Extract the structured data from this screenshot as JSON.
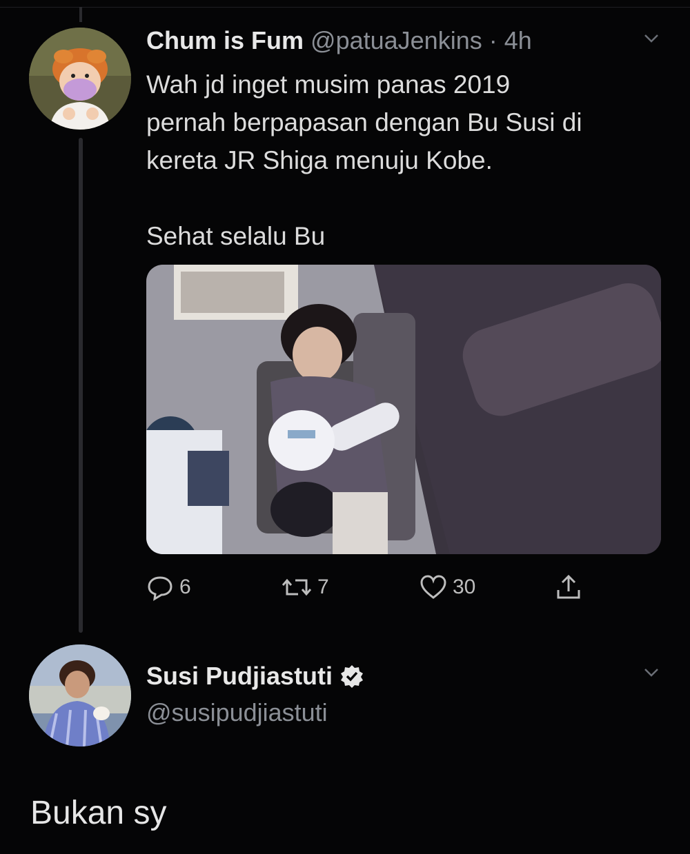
{
  "tweet": {
    "author_name": "Chum is Fum",
    "author_handle": "@patuaJenkins",
    "separator": "·",
    "time": "4h",
    "lines": [
      "Wah jd inget musim panas 2019",
      "pernah berpapasan dengan Bu Susi di",
      "kereta JR Shiga menuju Kobe."
    ],
    "closing": "Sehat selalu Bu",
    "avatar_icon": "cartoon-girl-mask-avatar",
    "media_icon": "train-passenger-photo",
    "stats": {
      "replies": "6",
      "retweets": "7",
      "likes": "30"
    }
  },
  "reply_tweet": {
    "author_name": "Susi Pudjiastuti",
    "author_handle": "@susipudjiastuti",
    "verified_icon": "verified-badge-icon",
    "avatar_icon": "woman-portrait-avatar",
    "text": "Bukan sy"
  },
  "colors": {
    "background": "#050506",
    "thread_line": "#2a2a2e",
    "handle": "#8b8f96"
  }
}
